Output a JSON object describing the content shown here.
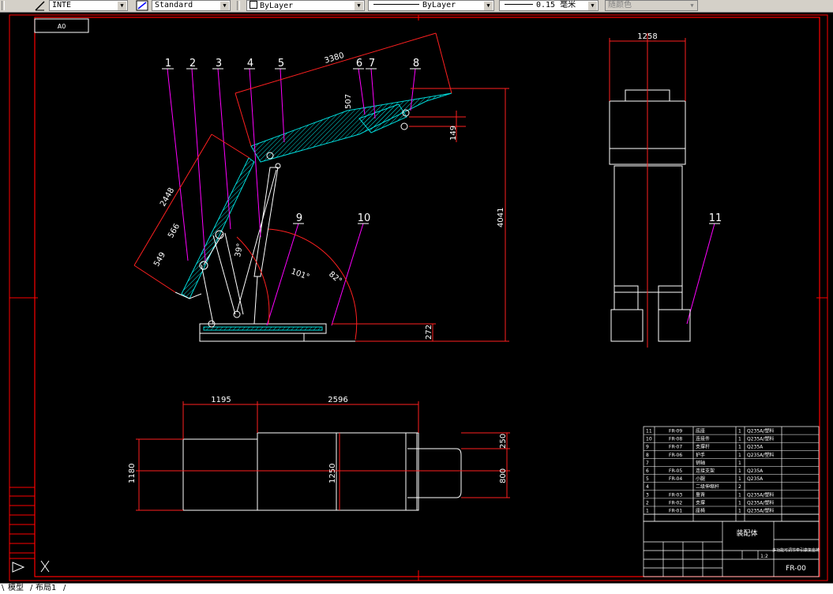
{
  "toolbar": {
    "textstyle": "INTE",
    "dimstyle": "Standard",
    "layer": "ByLayer",
    "linetype": "ByLayer",
    "lineweight": "0.15 毫米",
    "plotstyle": "随颜色"
  },
  "tabs": {
    "model": "模型",
    "layout": "布局1"
  },
  "drawing": {
    "sheet_label": "A0",
    "part_numbers": [
      "1",
      "2",
      "3",
      "4",
      "5",
      "6",
      "7",
      "8",
      "9",
      "10",
      "11"
    ],
    "dims": {
      "d3380": "3380",
      "d2448": "2448",
      "d566": "566",
      "d549": "549",
      "d507": "507",
      "d149": "149",
      "d4041": "4041",
      "d272": "272",
      "d1258": "1258",
      "d1195": "1195",
      "d2596": "2596",
      "d1180": "1180",
      "d1250": "1250",
      "d250": "250",
      "d800": "800",
      "a39": "39°",
      "a101": "101°",
      "a82": "82°"
    },
    "bom": [
      {
        "no": "11",
        "code": "FR-09",
        "name": "底座",
        "qty": "1",
        "mat": "Q235A/塑料"
      },
      {
        "no": "10",
        "code": "FR-08",
        "name": "连接件",
        "qty": "1",
        "mat": "Q235A/塑料"
      },
      {
        "no": "9",
        "code": "FR-07",
        "name": "支撑杆",
        "qty": "1",
        "mat": "Q235A"
      },
      {
        "no": "8",
        "code": "FR-06",
        "name": "护手",
        "qty": "1",
        "mat": "Q235A/塑料"
      },
      {
        "no": "7",
        "code": "",
        "name": "销轴",
        "qty": "1",
        "mat": ""
      },
      {
        "no": "6",
        "code": "FR-05",
        "name": "连接支架",
        "qty": "1",
        "mat": "Q235A"
      },
      {
        "no": "5",
        "code": "FR-04",
        "name": "小腿",
        "qty": "1",
        "mat": "Q235A"
      },
      {
        "no": "4",
        "code": "",
        "name": "二级伸缩杆",
        "qty": "2",
        "mat": ""
      },
      {
        "no": "3",
        "code": "FR-03",
        "name": "靠背",
        "qty": "1",
        "mat": "Q235A/塑料"
      },
      {
        "no": "2",
        "code": "FR-02",
        "name": "支撑",
        "qty": "1",
        "mat": "Q235A/塑料"
      },
      {
        "no": "1",
        "code": "FR-01",
        "name": "座椅",
        "qty": "1",
        "mat": "Q235A/塑料"
      }
    ],
    "title_block": {
      "assembly": "装配体",
      "description": "多功能可调节牵引康复座椅",
      "drawing_no": "FR-00",
      "scale": "1:2"
    }
  },
  "colors": {
    "background": "#000000",
    "border": "#ff0000",
    "outline": "#ffffff",
    "hatch": "#00d8d8",
    "leader": "#ff00ff",
    "dim": "#ff2020"
  }
}
